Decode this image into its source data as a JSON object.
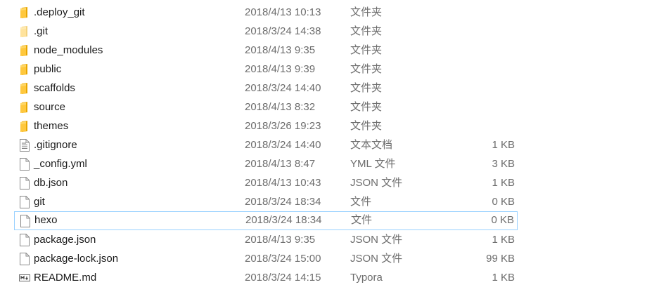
{
  "files": [
    {
      "name": ".deploy_git",
      "date": "2018/4/13 10:13",
      "type": "文件夹",
      "size": "",
      "icon": "folder-icon"
    },
    {
      "name": ".git",
      "date": "2018/3/24 14:38",
      "type": "文件夹",
      "size": "",
      "icon": "folder-hidden-icon"
    },
    {
      "name": "node_modules",
      "date": "2018/4/13 9:35",
      "type": "文件夹",
      "size": "",
      "icon": "folder-icon"
    },
    {
      "name": "public",
      "date": "2018/4/13 9:39",
      "type": "文件夹",
      "size": "",
      "icon": "folder-icon"
    },
    {
      "name": "scaffolds",
      "date": "2018/3/24 14:40",
      "type": "文件夹",
      "size": "",
      "icon": "folder-icon"
    },
    {
      "name": "source",
      "date": "2018/4/13 8:32",
      "type": "文件夹",
      "size": "",
      "icon": "folder-icon"
    },
    {
      "name": "themes",
      "date": "2018/3/26 19:23",
      "type": "文件夹",
      "size": "",
      "icon": "folder-icon"
    },
    {
      "name": ".gitignore",
      "date": "2018/3/24 14:40",
      "type": "文本文档",
      "size": "1 KB",
      "icon": "text-document-icon"
    },
    {
      "name": "_config.yml",
      "date": "2018/4/13 8:47",
      "type": "YML 文件",
      "size": "3 KB",
      "icon": "file-icon"
    },
    {
      "name": "db.json",
      "date": "2018/4/13 10:43",
      "type": "JSON 文件",
      "size": "1 KB",
      "icon": "file-icon"
    },
    {
      "name": "git",
      "date": "2018/3/24 18:34",
      "type": "文件",
      "size": "0 KB",
      "icon": "file-icon"
    },
    {
      "name": "hexo",
      "date": "2018/3/24 18:34",
      "type": "文件",
      "size": "0 KB",
      "icon": "file-icon",
      "selected": true
    },
    {
      "name": "package.json",
      "date": "2018/4/13 9:35",
      "type": "JSON 文件",
      "size": "1 KB",
      "icon": "file-icon"
    },
    {
      "name": "package-lock.json",
      "date": "2018/3/24 15:00",
      "type": "JSON 文件",
      "size": "99 KB",
      "icon": "file-icon"
    },
    {
      "name": "README.md",
      "date": "2018/3/24 14:15",
      "type": "Typora",
      "size": "1 KB",
      "icon": "typora-document-icon"
    }
  ],
  "colors": {
    "folder": "#ffc83d",
    "folder_dark": "#e8a600",
    "selection_border": "#99d1ff",
    "secondary_text": "#6d6d6d"
  }
}
